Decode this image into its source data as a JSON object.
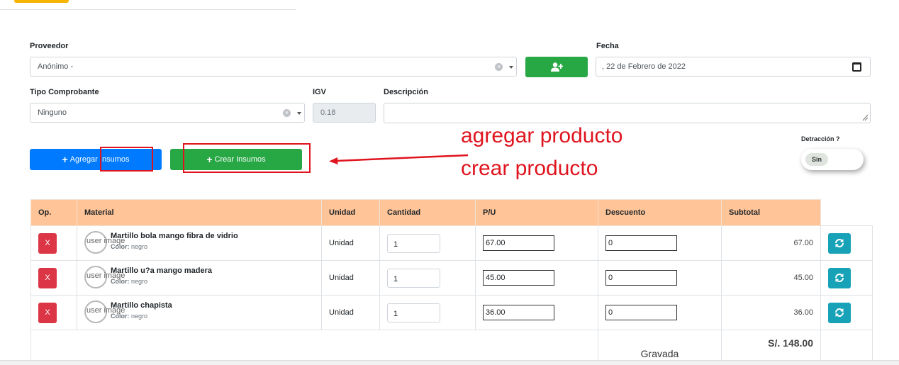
{
  "form": {
    "proveedor_label": "Proveedor",
    "proveedor_value": "Anónimo -",
    "fecha_label": "Fecha",
    "fecha_value": ", 22 de Febrero de 2022",
    "tipo_label": "Tipo Comprobante",
    "tipo_value": "Ninguno",
    "igv_label": "IGV",
    "igv_value": "0.18",
    "descripcion_label": "Descripción",
    "descripcion_value": ""
  },
  "buttons": {
    "agregar_label": "Agregar Insumos",
    "crear_label": "Crear Insumos"
  },
  "annotation": {
    "line1": "agregar producto",
    "line2": "crear producto",
    "color": "#e0141e"
  },
  "detraccion": {
    "label": "Detracción ?",
    "toggle_value": "Sin"
  },
  "table": {
    "headers": [
      "Op.",
      "Material",
      "Unidad",
      "Cantidad",
      "P/U",
      "Descuento",
      "Subtotal"
    ],
    "rows": [
      {
        "op": "X",
        "img_alt": "user image",
        "name": "Martillo bola mango fibra de vidrio",
        "color_label": "Color:",
        "color_value": "negro",
        "unidad": "Unidad",
        "cantidad": "1",
        "pu": "67.00",
        "descuento": "0",
        "subtotal": "67.00"
      },
      {
        "op": "X",
        "img_alt": "user image",
        "name": "Martillo u?a mango madera",
        "color_label": "Color:",
        "color_value": "negro",
        "unidad": "Unidad",
        "cantidad": "1",
        "pu": "45.00",
        "descuento": "0",
        "subtotal": "45.00"
      },
      {
        "op": "X",
        "img_alt": "user image",
        "name": "Martillo chapista",
        "color_label": "Color:",
        "color_value": "negro",
        "unidad": "Unidad",
        "cantidad": "1",
        "pu": "36.00",
        "descuento": "0",
        "subtotal": "36.00"
      }
    ],
    "gravada_label": "Gravada",
    "gravada_value": "S/. 148.00"
  },
  "colors": {
    "header_bg": "#ffc497",
    "primary": "#007bff",
    "success": "#28a745",
    "danger": "#dc3545",
    "info": "#17a2b8"
  },
  "icons": {
    "add_user": "user-plus-icon",
    "calendar": "calendar-icon",
    "refresh": "sync-icon"
  }
}
